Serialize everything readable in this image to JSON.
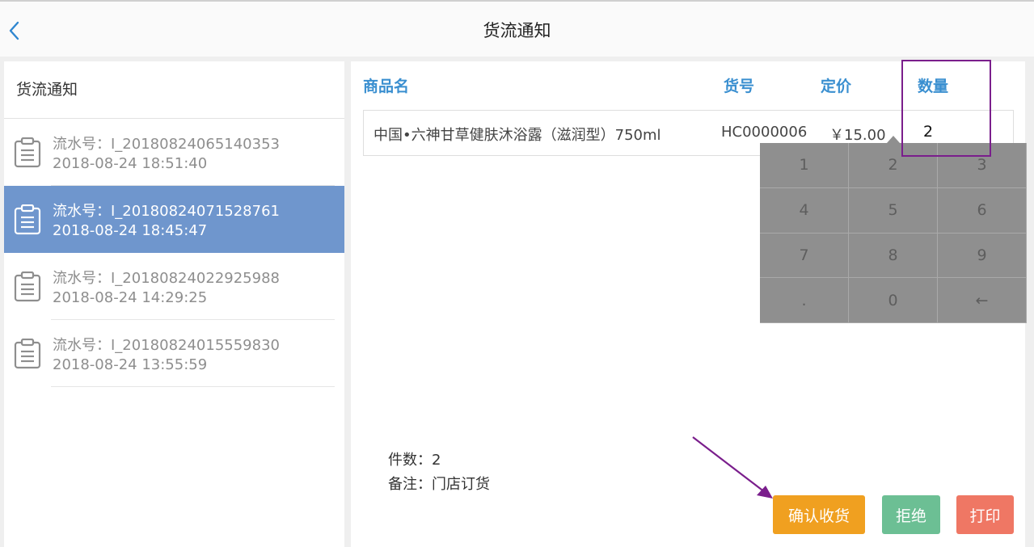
{
  "header": {
    "title": "货流通知"
  },
  "sidebar": {
    "title": "货流通知",
    "items": [
      {
        "serial": "流水号：I_20180824065140353",
        "time": "2018-08-24 18:51:40"
      },
      {
        "serial": "流水号：I_20180824071528761",
        "time": "2018-08-24 18:45:47"
      },
      {
        "serial": "流水号：I_20180824022925988",
        "time": "2018-08-24 14:29:25"
      },
      {
        "serial": "流水号：I_20180824015559830",
        "time": "2018-08-24 13:55:59"
      }
    ],
    "active_index": 1
  },
  "table": {
    "headers": {
      "name": "商品名",
      "code": "货号",
      "price": "定价",
      "qty": "数量"
    },
    "rows": [
      {
        "name": "中国•六神甘草健肤沐浴露（滋润型）750ml",
        "code": "HC0000006",
        "price": "￥15.00",
        "qty": "2"
      }
    ]
  },
  "keypad": {
    "keys": [
      "1",
      "2",
      "3",
      "4",
      "5",
      "6",
      "7",
      "8",
      "9",
      ".",
      "0",
      "←"
    ]
  },
  "summary": {
    "count_label": "件数：2",
    "remark_label": "备注：门店订货"
  },
  "actions": {
    "confirm": "确认收货",
    "reject": "拒绝",
    "print": "打印"
  },
  "colors": {
    "accent": "#3a8fd0",
    "selected_row": "#6f96cd",
    "confirm": "#f0a020",
    "reject": "#6cbf94",
    "print": "#ef7764",
    "annotation": "#7a1e8c"
  }
}
